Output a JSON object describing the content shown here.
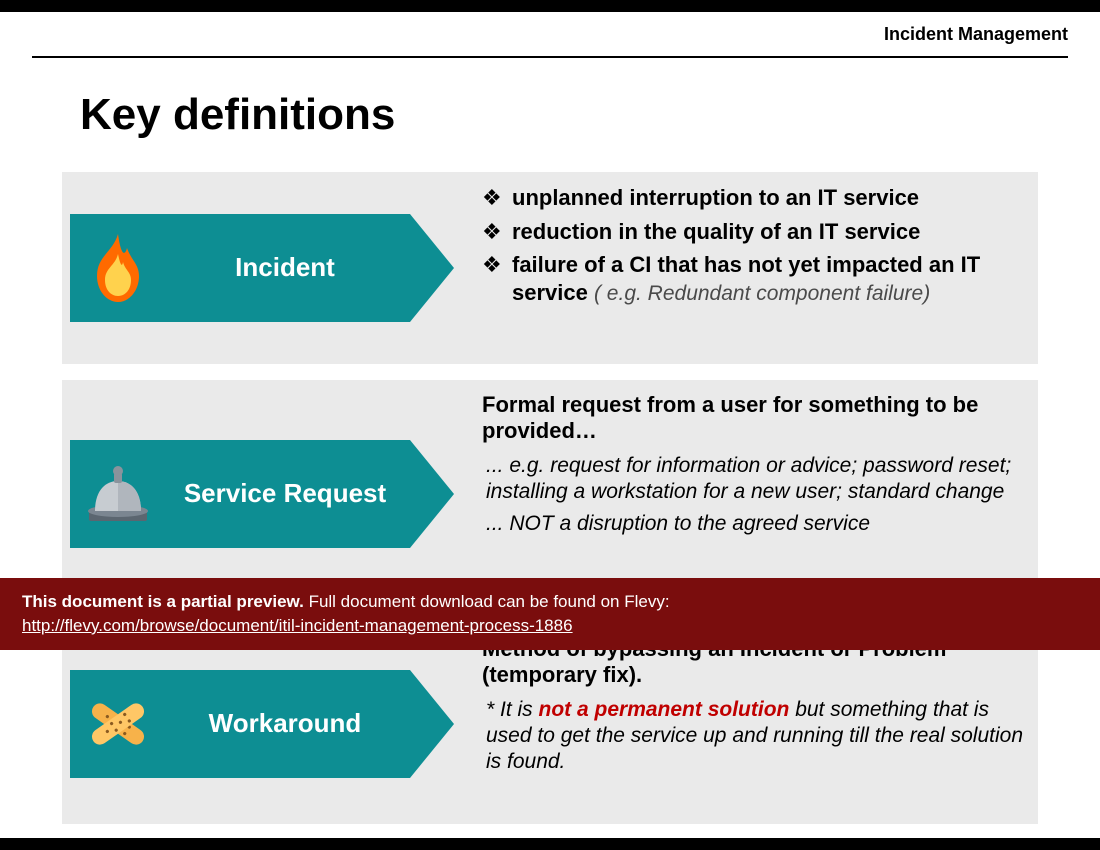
{
  "header": {
    "label": "Incident Management"
  },
  "title": "Key definitions",
  "colors": {
    "accent": "#0d8e93",
    "banner": "#7a0d0d",
    "card": "#eaeaea",
    "emph": "#c00000"
  },
  "cards": [
    {
      "icon": "flame-icon",
      "label": "Incident",
      "bullets": [
        {
          "text": "unplanned interruption to an IT service"
        },
        {
          "text": "reduction in the quality of an IT service"
        },
        {
          "text": "failure of a CI that has not yet impacted an IT service",
          "example": "( e.g.  Redundant component failure)"
        }
      ]
    },
    {
      "icon": "bell-icon",
      "label": "Service Request",
      "lead": "Formal request from a user for something to be provided…",
      "subs": [
        "... e.g. request for information or advice; password reset; installing a workstation for a new user; standard change",
        "... NOT a disruption to the agreed service"
      ]
    },
    {
      "icon": "bandage-icon",
      "label": "Workaround",
      "lead": "Method of bypassing an Incident or Problem (temporary fix).",
      "note_prefix": "* It is ",
      "note_emph": "not a permanent solution",
      "note_suffix": " but something that is used to get the service up and running till the real solution is found."
    }
  ],
  "banner": {
    "bold": "This document is a partial preview.",
    "rest": "  Full document download can be found on Flevy:",
    "url": "http://flevy.com/browse/document/itil-incident-management-process-1886"
  }
}
